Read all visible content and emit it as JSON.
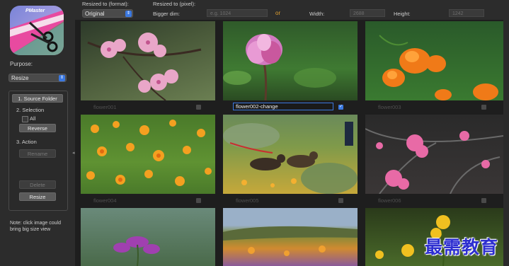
{
  "app": {
    "icon_text": "PMaster"
  },
  "sidebar": {
    "purpose_label": "Purpose:",
    "purpose_value": "Resize",
    "steps": {
      "source_folder": "1. Source Folder",
      "selection": "2. Selection",
      "all": "All",
      "reverse": "Reverse",
      "action": "3. Action",
      "rename": "Rename",
      "delete": "Delete",
      "resize": "Resize"
    },
    "note": "Note: click image could bring big size view"
  },
  "topbar": {
    "format_label": "Resized to (format):",
    "format_value": "Original",
    "pixel_label": "Resized to (pixel):",
    "bigger_dim_label": "Bigger dim:",
    "bigger_dim_placeholder": "e.g. 1024",
    "or_label": "or",
    "width_label": "Width:",
    "width_value": "2688",
    "height_label": "Height:",
    "height_value": "1242"
  },
  "images": [
    {
      "caption": "flower001",
      "checked": false,
      "editing": false
    },
    {
      "caption": "flower002-change",
      "checked": true,
      "editing": true
    },
    {
      "caption": "flower003",
      "checked": false,
      "editing": false
    },
    {
      "caption": "flower004",
      "checked": false,
      "editing": false
    },
    {
      "caption": "flower005",
      "checked": false,
      "editing": false
    },
    {
      "caption": "flower006",
      "checked": false,
      "editing": false
    }
  ],
  "watermark": "最需教育",
  "colors": {
    "accent": "#3b78e0",
    "background": "#242424",
    "panel": "#2c2c2c"
  }
}
